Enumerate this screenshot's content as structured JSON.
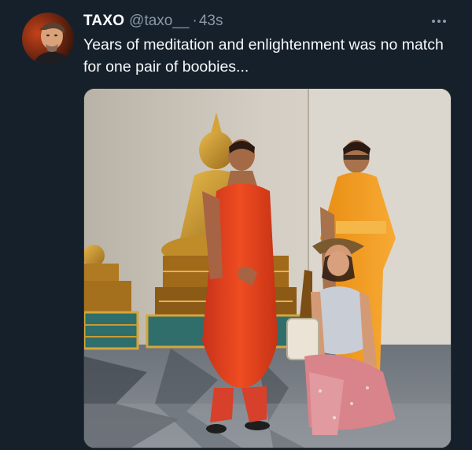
{
  "tweet": {
    "author_name": "TAXO",
    "author_handle": "@taxo__",
    "separator": "·",
    "timestamp": "43s",
    "text": "Years of meditation and enlightenment was no match for one pair of boobies...",
    "more_icon": "more-horizontal-icon"
  },
  "media": {
    "description_icon": "photo"
  },
  "colors": {
    "background": "#15202b",
    "text_primary": "#f7f9f9",
    "text_secondary": "#8b98a5",
    "robe_red": "#e2431c",
    "robe_orange": "#f39a1c",
    "buddha_gold": "#c8962a"
  }
}
